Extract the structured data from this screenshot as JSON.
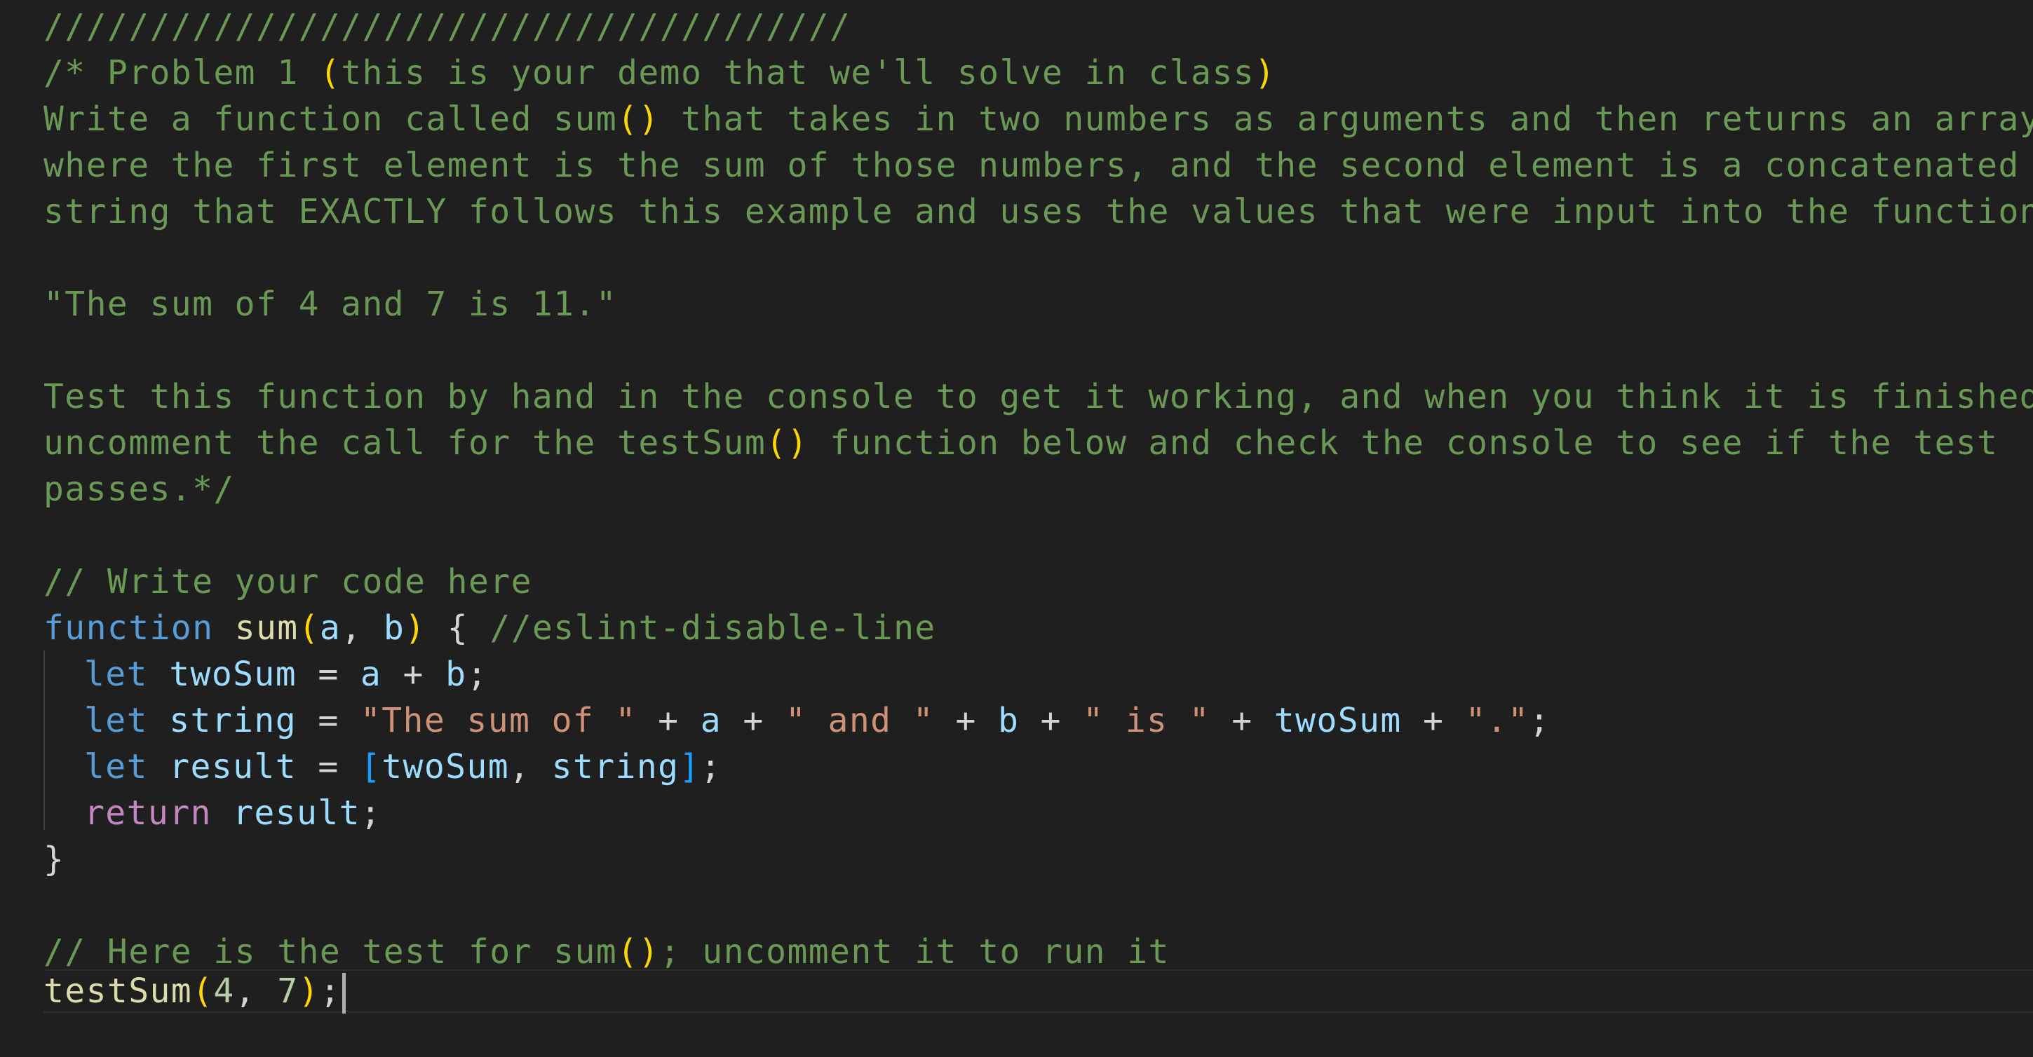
{
  "colors": {
    "background": "#1f1f1f",
    "comment": "#6a9955",
    "keyword": "#569cd6",
    "function": "#dcdcaa",
    "variable": "#9cdcfe",
    "string": "#ce9178",
    "number": "#b5cea8",
    "control": "#c586c0",
    "bracket": "#ffd700"
  },
  "lines": {
    "l1": "//////////////////////////////////////",
    "l2": {
      "a": "/* Problem 1 ",
      "b": "(",
      "c": "this is your demo that we'll solve in class",
      "d": ")"
    },
    "l3": {
      "a": "Write a function called sum",
      "b": "()",
      "c": " that takes in two numbers as arguments and then returns an array"
    },
    "l4": "where the first element is the sum of those numbers, and the second element is a concatenated",
    "l5": "string that EXACTLY follows this example and uses the values that were input into the function:",
    "l7": "\"The sum of 4 and 7 is 11.\"",
    "l9": "Test this function by hand in the console to get it working, and when you think it is finished,",
    "l10": {
      "a": "uncomment the call for the testSum",
      "b": "()",
      "c": " function below and check the console to see if the test"
    },
    "l11": "passes.*/",
    "l13": "// Write your code here",
    "l14": {
      "kw": "function",
      "fn": "sum",
      "p1": "a",
      "p2": "b",
      "brace": "{",
      "comment": "//eslint-disable-line"
    },
    "l15": {
      "kw": "let",
      "v": "twoSum",
      "a": "a",
      "b": "b"
    },
    "l16": {
      "kw": "let",
      "v": "string",
      "s1": "\"The sum of \"",
      "a": "a",
      "s2": "\" and \"",
      "b": "b",
      "s3": "\" is \"",
      "t": "twoSum",
      "s4": "\".\""
    },
    "l17": {
      "kw": "let",
      "v": "result",
      "e1": "twoSum",
      "e2": "string"
    },
    "l18": {
      "kw": "return",
      "v": "result"
    },
    "l19": "}",
    "l21": {
      "a": "// Here is the test for sum",
      "b": "()",
      "c": "; uncomment it to run it"
    },
    "l22": {
      "fn": "testSum",
      "n1": "4",
      "n2": "7"
    }
  }
}
